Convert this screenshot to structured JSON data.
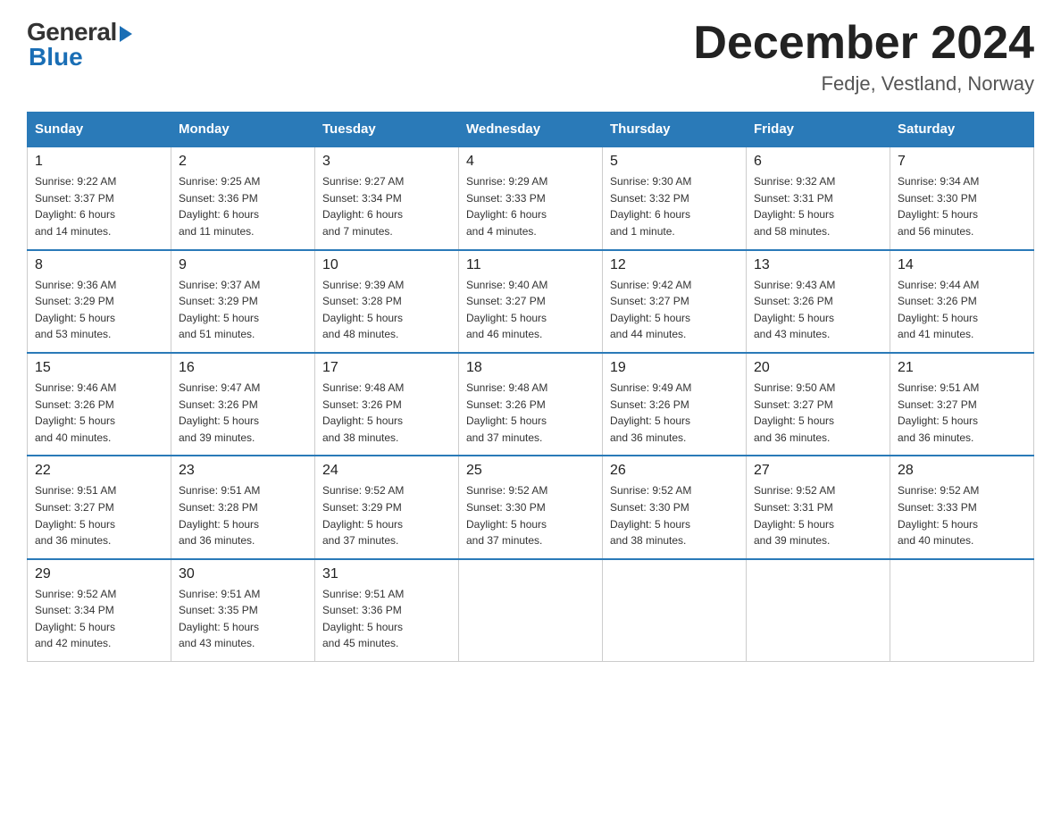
{
  "header": {
    "logo_general": "General",
    "logo_blue": "Blue",
    "title": "December 2024",
    "subtitle": "Fedje, Vestland, Norway"
  },
  "columns": [
    "Sunday",
    "Monday",
    "Tuesday",
    "Wednesday",
    "Thursday",
    "Friday",
    "Saturday"
  ],
  "weeks": [
    [
      {
        "day": "1",
        "info": "Sunrise: 9:22 AM\nSunset: 3:37 PM\nDaylight: 6 hours\nand 14 minutes."
      },
      {
        "day": "2",
        "info": "Sunrise: 9:25 AM\nSunset: 3:36 PM\nDaylight: 6 hours\nand 11 minutes."
      },
      {
        "day": "3",
        "info": "Sunrise: 9:27 AM\nSunset: 3:34 PM\nDaylight: 6 hours\nand 7 minutes."
      },
      {
        "day": "4",
        "info": "Sunrise: 9:29 AM\nSunset: 3:33 PM\nDaylight: 6 hours\nand 4 minutes."
      },
      {
        "day": "5",
        "info": "Sunrise: 9:30 AM\nSunset: 3:32 PM\nDaylight: 6 hours\nand 1 minute."
      },
      {
        "day": "6",
        "info": "Sunrise: 9:32 AM\nSunset: 3:31 PM\nDaylight: 5 hours\nand 58 minutes."
      },
      {
        "day": "7",
        "info": "Sunrise: 9:34 AM\nSunset: 3:30 PM\nDaylight: 5 hours\nand 56 minutes."
      }
    ],
    [
      {
        "day": "8",
        "info": "Sunrise: 9:36 AM\nSunset: 3:29 PM\nDaylight: 5 hours\nand 53 minutes."
      },
      {
        "day": "9",
        "info": "Sunrise: 9:37 AM\nSunset: 3:29 PM\nDaylight: 5 hours\nand 51 minutes."
      },
      {
        "day": "10",
        "info": "Sunrise: 9:39 AM\nSunset: 3:28 PM\nDaylight: 5 hours\nand 48 minutes."
      },
      {
        "day": "11",
        "info": "Sunrise: 9:40 AM\nSunset: 3:27 PM\nDaylight: 5 hours\nand 46 minutes."
      },
      {
        "day": "12",
        "info": "Sunrise: 9:42 AM\nSunset: 3:27 PM\nDaylight: 5 hours\nand 44 minutes."
      },
      {
        "day": "13",
        "info": "Sunrise: 9:43 AM\nSunset: 3:26 PM\nDaylight: 5 hours\nand 43 minutes."
      },
      {
        "day": "14",
        "info": "Sunrise: 9:44 AM\nSunset: 3:26 PM\nDaylight: 5 hours\nand 41 minutes."
      }
    ],
    [
      {
        "day": "15",
        "info": "Sunrise: 9:46 AM\nSunset: 3:26 PM\nDaylight: 5 hours\nand 40 minutes."
      },
      {
        "day": "16",
        "info": "Sunrise: 9:47 AM\nSunset: 3:26 PM\nDaylight: 5 hours\nand 39 minutes."
      },
      {
        "day": "17",
        "info": "Sunrise: 9:48 AM\nSunset: 3:26 PM\nDaylight: 5 hours\nand 38 minutes."
      },
      {
        "day": "18",
        "info": "Sunrise: 9:48 AM\nSunset: 3:26 PM\nDaylight: 5 hours\nand 37 minutes."
      },
      {
        "day": "19",
        "info": "Sunrise: 9:49 AM\nSunset: 3:26 PM\nDaylight: 5 hours\nand 36 minutes."
      },
      {
        "day": "20",
        "info": "Sunrise: 9:50 AM\nSunset: 3:27 PM\nDaylight: 5 hours\nand 36 minutes."
      },
      {
        "day": "21",
        "info": "Sunrise: 9:51 AM\nSunset: 3:27 PM\nDaylight: 5 hours\nand 36 minutes."
      }
    ],
    [
      {
        "day": "22",
        "info": "Sunrise: 9:51 AM\nSunset: 3:27 PM\nDaylight: 5 hours\nand 36 minutes."
      },
      {
        "day": "23",
        "info": "Sunrise: 9:51 AM\nSunset: 3:28 PM\nDaylight: 5 hours\nand 36 minutes."
      },
      {
        "day": "24",
        "info": "Sunrise: 9:52 AM\nSunset: 3:29 PM\nDaylight: 5 hours\nand 37 minutes."
      },
      {
        "day": "25",
        "info": "Sunrise: 9:52 AM\nSunset: 3:30 PM\nDaylight: 5 hours\nand 37 minutes."
      },
      {
        "day": "26",
        "info": "Sunrise: 9:52 AM\nSunset: 3:30 PM\nDaylight: 5 hours\nand 38 minutes."
      },
      {
        "day": "27",
        "info": "Sunrise: 9:52 AM\nSunset: 3:31 PM\nDaylight: 5 hours\nand 39 minutes."
      },
      {
        "day": "28",
        "info": "Sunrise: 9:52 AM\nSunset: 3:33 PM\nDaylight: 5 hours\nand 40 minutes."
      }
    ],
    [
      {
        "day": "29",
        "info": "Sunrise: 9:52 AM\nSunset: 3:34 PM\nDaylight: 5 hours\nand 42 minutes."
      },
      {
        "day": "30",
        "info": "Sunrise: 9:51 AM\nSunset: 3:35 PM\nDaylight: 5 hours\nand 43 minutes."
      },
      {
        "day": "31",
        "info": "Sunrise: 9:51 AM\nSunset: 3:36 PM\nDaylight: 5 hours\nand 45 minutes."
      },
      {
        "day": "",
        "info": ""
      },
      {
        "day": "",
        "info": ""
      },
      {
        "day": "",
        "info": ""
      },
      {
        "day": "",
        "info": ""
      }
    ]
  ]
}
